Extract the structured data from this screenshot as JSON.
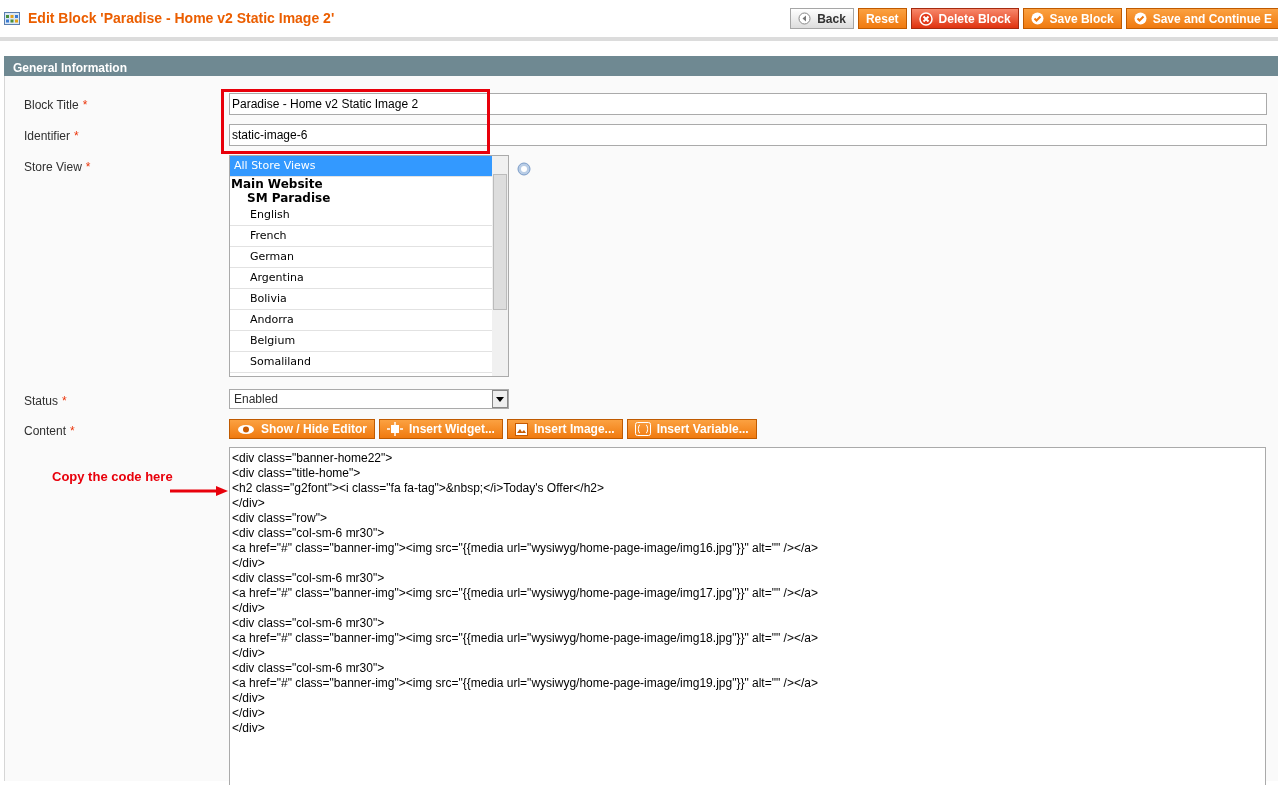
{
  "header": {
    "title": "Edit Block 'Paradise - Home v2 Static Image 2'",
    "buttons": [
      {
        "label": "Back",
        "kind": "back"
      },
      {
        "label": "Reset",
        "kind": "plain"
      },
      {
        "label": "Delete Block",
        "kind": "delete"
      },
      {
        "label": "Save Block",
        "kind": "save"
      },
      {
        "label": "Save and Continue E",
        "kind": "save"
      }
    ]
  },
  "section": {
    "title": "General Information",
    "fields": [
      {
        "label": "Block Title",
        "required_mark": "*",
        "kind": "text",
        "value": "Paradise - Home v2 Static Image 2"
      },
      {
        "label": "Identifier",
        "required_mark": "*",
        "kind": "text",
        "value": "static-image-6"
      },
      {
        "label": "Store View",
        "required_mark": "*",
        "kind": "multiselect",
        "options": [
          {
            "label": "All Store Views",
            "kind": "option",
            "selected": true
          },
          {
            "label": "Main Website",
            "kind": "group",
            "selected": false
          },
          {
            "label": "SM Paradise",
            "kind": "subgroup",
            "selected": false
          },
          {
            "label": "English",
            "kind": "option",
            "selected": false
          },
          {
            "label": "French",
            "kind": "option",
            "selected": false
          },
          {
            "label": "German",
            "kind": "option",
            "selected": false
          },
          {
            "label": "Argentina",
            "kind": "option",
            "selected": false
          },
          {
            "label": "Bolivia",
            "kind": "option",
            "selected": false
          },
          {
            "label": "Andorra",
            "kind": "option",
            "selected": false
          },
          {
            "label": "Belgium",
            "kind": "option",
            "selected": false
          },
          {
            "label": "Somaliland",
            "kind": "option",
            "selected": false
          }
        ]
      },
      {
        "label": "Status",
        "required_mark": "*",
        "kind": "select",
        "value": "Enabled"
      },
      {
        "label": "Content",
        "required_mark": "*",
        "kind": "editor",
        "buttons": [
          {
            "label": "Show / Hide Editor",
            "kind": "eye"
          },
          {
            "label": "Insert Widget...",
            "kind": "widget"
          },
          {
            "label": "Insert Image...",
            "kind": "image"
          },
          {
            "label": "Insert Variable...",
            "kind": "variable"
          }
        ],
        "lines": [
          "<div class=\"banner-home22\">",
          "<div class=\"title-home\">",
          "<h2 class=\"g2font\"><i class=\"fa fa-tag\">&nbsp;</i>Today's Offer</h2>",
          "</div>",
          "<div class=\"row\">",
          "<div class=\"col-sm-6 mr30\">",
          "<a href=\"#\" class=\"banner-img\"><img src=\"{{media url=\"wysiwyg/home-page-image/img16.jpg\"}}\" alt=\"\" /></a>",
          "</div>",
          "<div class=\"col-sm-6 mr30\">",
          "<a href=\"#\" class=\"banner-img\"><img src=\"{{media url=\"wysiwyg/home-page-image/img17.jpg\"}}\" alt=\"\" /></a>",
          "</div>",
          "<div class=\"col-sm-6 mr30\">",
          "<a href=\"#\" class=\"banner-img\"><img src=\"{{media url=\"wysiwyg/home-page-image/img18.jpg\"}}\" alt=\"\" /></a>",
          "</div>",
          "<div class=\"col-sm-6 mr30\">",
          "<a href=\"#\" class=\"banner-img\"><img src=\"{{media url=\"wysiwyg/home-page-image/img19.jpg\"}}\" alt=\"\" /></a>",
          "</div>",
          "</div>",
          "</div>"
        ]
      }
    ]
  },
  "annotation": {
    "text": "Copy the code here"
  }
}
